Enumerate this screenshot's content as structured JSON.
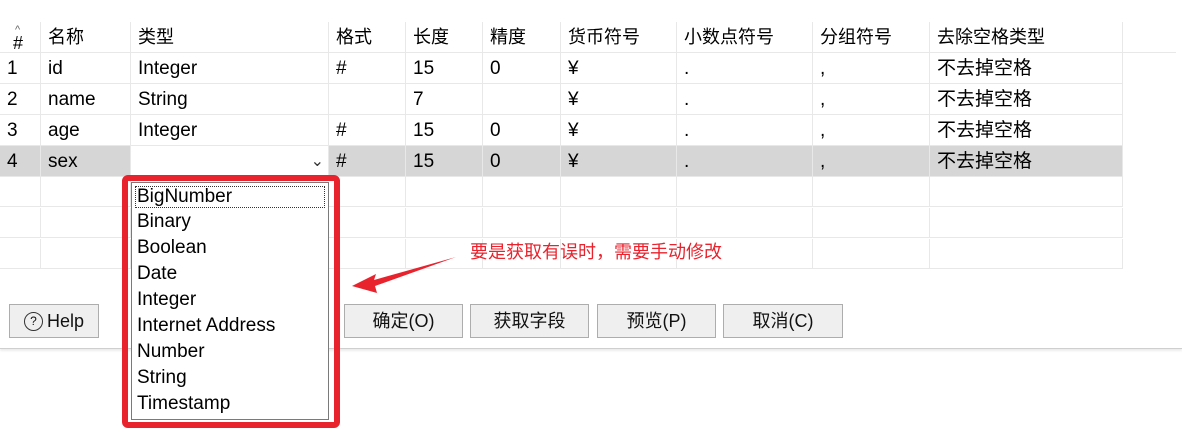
{
  "columns": {
    "num": "#",
    "name": "名称",
    "type": "类型",
    "format": "格式",
    "length": "长度",
    "precision": "精度",
    "currency": "货币符号",
    "decimal": "小数点符号",
    "group": "分组符号",
    "trim": "去除空格类型"
  },
  "rows": [
    {
      "num": "1",
      "name": "id",
      "type": "Integer",
      "format": "#",
      "length": "15",
      "precision": "0",
      "currency": "¥",
      "decimal": ".",
      "group": ",",
      "trim": "不去掉空格"
    },
    {
      "num": "2",
      "name": "name",
      "type": "String",
      "format": "",
      "length": "7",
      "precision": "",
      "currency": "¥",
      "decimal": ".",
      "group": ",",
      "trim": "不去掉空格"
    },
    {
      "num": "3",
      "name": "age",
      "type": "Integer",
      "format": "#",
      "length": "15",
      "precision": "0",
      "currency": "¥",
      "decimal": ".",
      "group": ",",
      "trim": "不去掉空格"
    },
    {
      "num": "4",
      "name": "sex",
      "type": "",
      "format": "#",
      "length": "15",
      "precision": "0",
      "currency": "¥",
      "decimal": ".",
      "group": ",",
      "trim": "不去掉空格"
    }
  ],
  "dropdown_options": [
    "BigNumber",
    "Binary",
    "Boolean",
    "Date",
    "Integer",
    "Internet Address",
    "Number",
    "String",
    "Timestamp"
  ],
  "buttons": {
    "help": "Help",
    "ok": "确定(O)",
    "get_fields": "获取字段",
    "preview": "预览(P)",
    "cancel": "取消(C)"
  },
  "annotation": "要是获取有误时，需要手动修改",
  "colors": {
    "annotation": "#e8232d",
    "selected_row": "#d6d6d6"
  }
}
